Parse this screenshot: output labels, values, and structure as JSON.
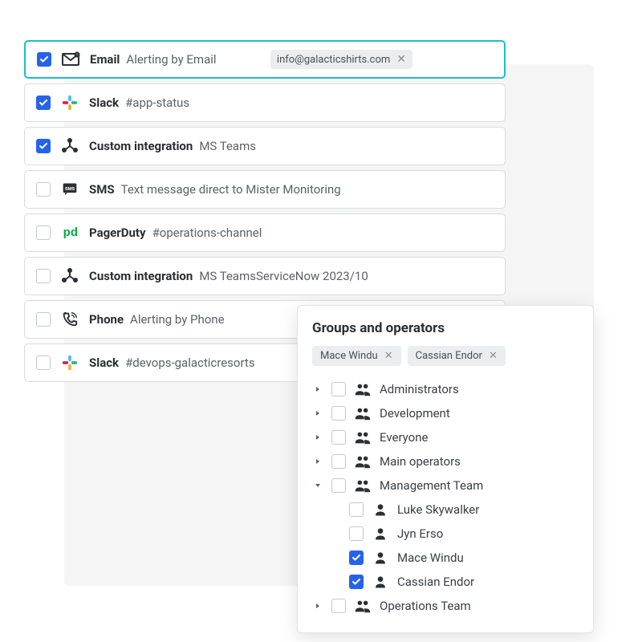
{
  "channels": [
    {
      "checked": true,
      "selected": true,
      "icon": "email",
      "name": "Email",
      "desc": "Alerting by Email",
      "tag": "info@galacticshirts.com"
    },
    {
      "checked": true,
      "icon": "slack",
      "name": "Slack",
      "desc": "#app-status"
    },
    {
      "checked": true,
      "icon": "custom",
      "name": "Custom integration",
      "desc": "MS Teams"
    },
    {
      "checked": false,
      "icon": "sms",
      "name": "SMS",
      "desc": "Text message direct to Mister Monitoring"
    },
    {
      "checked": false,
      "icon": "pagerduty",
      "name": "PagerDuty",
      "desc": "#operations-channel"
    },
    {
      "checked": false,
      "icon": "custom",
      "name": "Custom integration",
      "desc": "MS TeamsServiceNow 2023/10"
    },
    {
      "checked": false,
      "icon": "phone",
      "name": "Phone",
      "desc": "Alerting by Phone"
    },
    {
      "checked": false,
      "icon": "slack",
      "name": "Slack",
      "desc": "#devops-galacticresorts"
    }
  ],
  "popup": {
    "title": "Groups and operators",
    "chips": [
      "Mace Windu",
      "Cassian Endor"
    ],
    "groups": [
      {
        "label": "Administrators",
        "expanded": false
      },
      {
        "label": "Development",
        "expanded": false
      },
      {
        "label": "Everyone",
        "expanded": false
      },
      {
        "label": "Main operators",
        "expanded": false
      },
      {
        "label": "Management Team",
        "expanded": true,
        "members": [
          {
            "label": "Luke Skywalker",
            "checked": false
          },
          {
            "label": "Jyn Erso",
            "checked": false
          },
          {
            "label": "Mace Windu",
            "checked": true
          },
          {
            "label": "Cassian Endor",
            "checked": true
          }
        ]
      },
      {
        "label": "Operations Team",
        "expanded": false
      }
    ]
  }
}
